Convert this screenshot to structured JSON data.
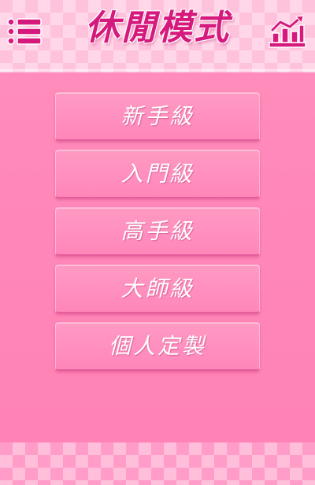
{
  "header": {
    "title": "休閒模式",
    "menu_icon": "list-menu-icon",
    "chart_icon": "bar-chart-trend-icon"
  },
  "levels": [
    {
      "label": "新手級"
    },
    {
      "label": "入門級"
    },
    {
      "label": "高手級"
    },
    {
      "label": "大師級"
    },
    {
      "label": "個人定製"
    }
  ],
  "colors": {
    "background": "#ff86b8",
    "title": "#d6197d",
    "button": "#ff8fbf",
    "button_text": "#ffffff"
  }
}
